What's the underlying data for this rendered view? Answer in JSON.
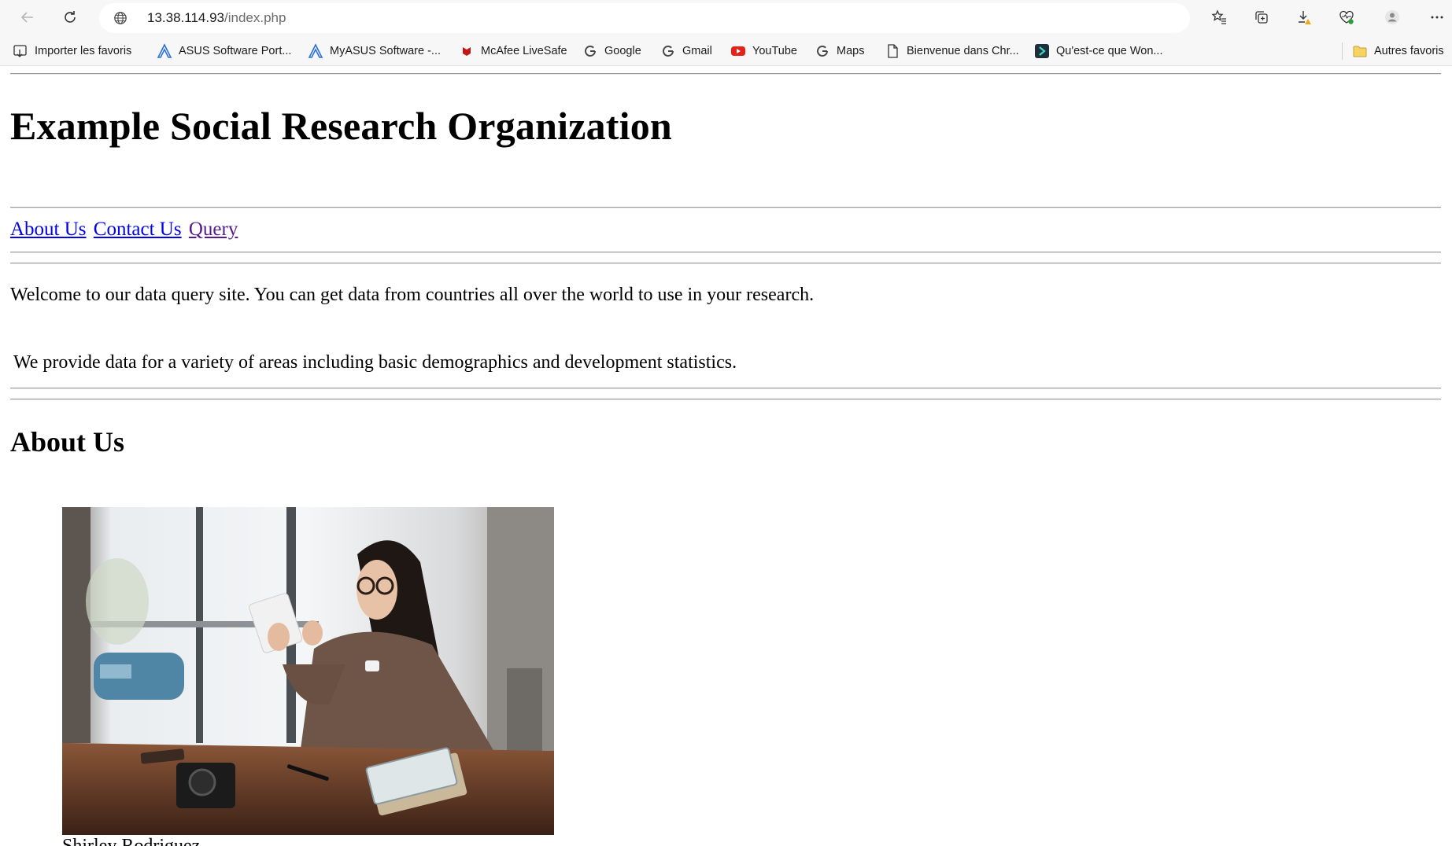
{
  "browser": {
    "url_host": "13.38.114.93",
    "url_path": "/index.php",
    "bookmarks": [
      {
        "label": "Importer les favoris",
        "icon": "import-icon"
      },
      {
        "label": "ASUS Software Port...",
        "icon": "asus-icon"
      },
      {
        "label": "MyASUS Software -...",
        "icon": "asus-icon"
      },
      {
        "label": "McAfee LiveSafe",
        "icon": "mcafee-icon"
      },
      {
        "label": "Google",
        "icon": "google-icon"
      },
      {
        "label": "Gmail",
        "icon": "google-icon"
      },
      {
        "label": "YouTube",
        "icon": "youtube-icon"
      },
      {
        "label": "Maps",
        "icon": "google-icon"
      },
      {
        "label": "Bienvenue dans Chr...",
        "icon": "page-icon"
      },
      {
        "label": "Qu'est-ce que Won...",
        "icon": "wondershare-icon"
      }
    ],
    "other_favorites": "Autres favoris"
  },
  "page": {
    "title": "Example Social Research Organization",
    "nav": {
      "about": "About Us",
      "contact": "Contact Us",
      "query": "Query"
    },
    "welcome": "Welcome to our data query site. You can get data from countries all over the world to use in your research.",
    "provide": "We provide data for a variety of areas including basic demographics and development statistics.",
    "about_heading": "About Us",
    "person_name": "Shirley Rodriguez"
  },
  "colors": {
    "link": "#0000ee",
    "visited_link": "#551a8b",
    "chrome_bg": "#f7f7f7"
  }
}
